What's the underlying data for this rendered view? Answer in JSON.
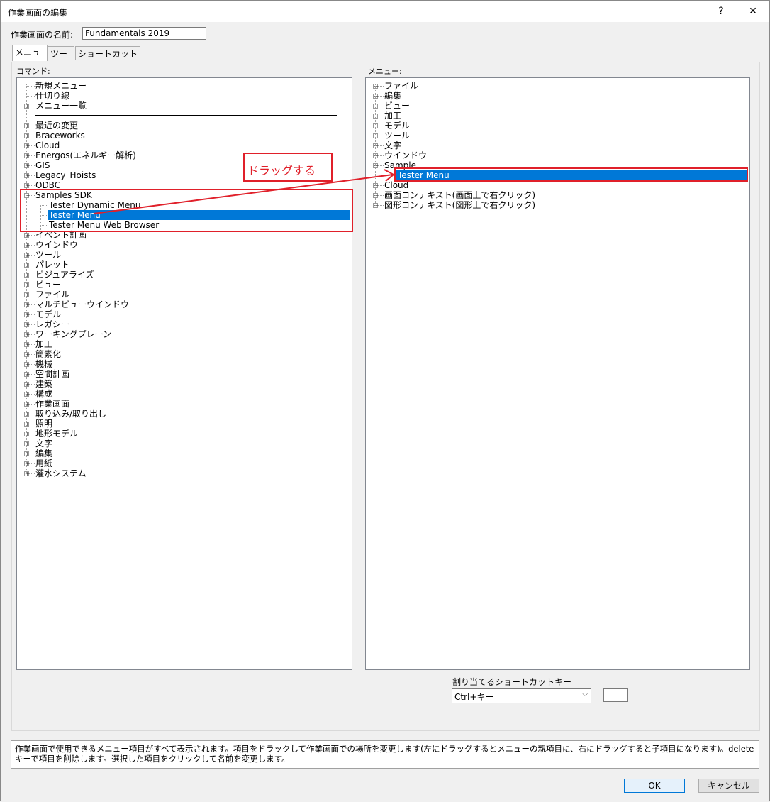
{
  "window": {
    "title": "作業画面の編集",
    "help": "?",
    "close": "✕"
  },
  "workspace": {
    "name_label": "作業画面の名前:",
    "name_value": "Fundamentals 2019"
  },
  "tabs": [
    {
      "label": "メニュー"
    },
    {
      "label": "ツール"
    },
    {
      "label": "ショートカットキー"
    }
  ],
  "commands": {
    "label": "コマンド:",
    "items": [
      "新規メニュー",
      "仕切り線",
      "メニュー一覧",
      "",
      "最近の変更",
      "Braceworks",
      "Cloud",
      "Energos(エネルギー解析)",
      "GIS",
      "Legacy_Hoists",
      "ODBC",
      "Samples SDK",
      "Tester Dynamic Menu",
      "Tester Menu",
      "Tester Menu Web Browser",
      "イベント計画",
      "ウインドウ",
      "ツール",
      "パレット",
      "ビジュアライズ",
      "ビュー",
      "ファイル",
      "マルチビューウインドウ",
      "モデル",
      "レガシー",
      "ワーキングプレーン",
      "加工",
      "簡素化",
      "機械",
      "空間計画",
      "建築",
      "構成",
      "作業画面",
      "取り込み/取り出し",
      "照明",
      "地形モデル",
      "文字",
      "編集",
      "用紙",
      "灌水システム"
    ]
  },
  "menus": {
    "label": "メニュー:",
    "items": [
      "ファイル",
      "編集",
      "ビュー",
      "加工",
      "モデル",
      "ツール",
      "文字",
      "ウインドウ",
      "Sample",
      "Tester Menu",
      "Cloud",
      "画面コンテキスト(画面上で右クリック)",
      "図形コンテキスト(図形上で右クリック)"
    ]
  },
  "annotation": {
    "label": "ドラッグする",
    "color": "#e0202a"
  },
  "shortcut": {
    "label": "割り当てるショートカットキー",
    "select_value": "Ctrl+キー",
    "key_value": ""
  },
  "status_text": "作業画面で使用できるメニュー項目がすべて表示されます。項目をドラックして作業画面での場所を変更します(左にドラッグするとメニューの親項目に、右にドラッグすると子項目になります)。deleteキーで項目を削除します。選択した項目をクリックして名前を変更します。",
  "buttons": {
    "ok": "OK",
    "cancel": "キャンセル"
  },
  "colors": {
    "selection": "#0078d7",
    "accent_red": "#e0202a"
  }
}
